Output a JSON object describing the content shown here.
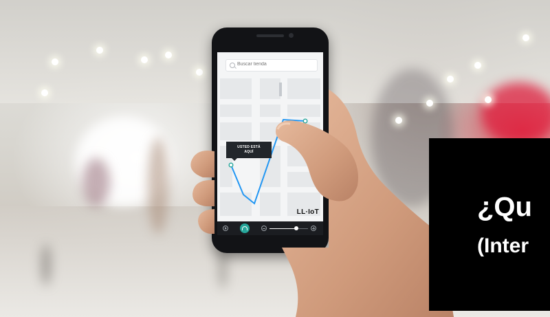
{
  "app": {
    "search": {
      "placeholder": "Buscar tienda"
    },
    "map": {
      "location_bubble": [
        "USTED ESTÁ",
        "AQUÍ"
      ],
      "route_color": "#2196f3",
      "node_color": "#26a69a"
    },
    "brand": "LL·IoT",
    "bottom_bar": {
      "icons": [
        "play-icon",
        "navigation-icon",
        "zoom-out-icon",
        "zoom-in-icon"
      ],
      "zoom_level": 0.7
    }
  },
  "overlay": {
    "title": "¿Qu",
    "subtitle": "(Inter"
  },
  "colors": {
    "accent": "#26a69a",
    "route": "#2196f3",
    "overlay_bg": "#000000"
  }
}
